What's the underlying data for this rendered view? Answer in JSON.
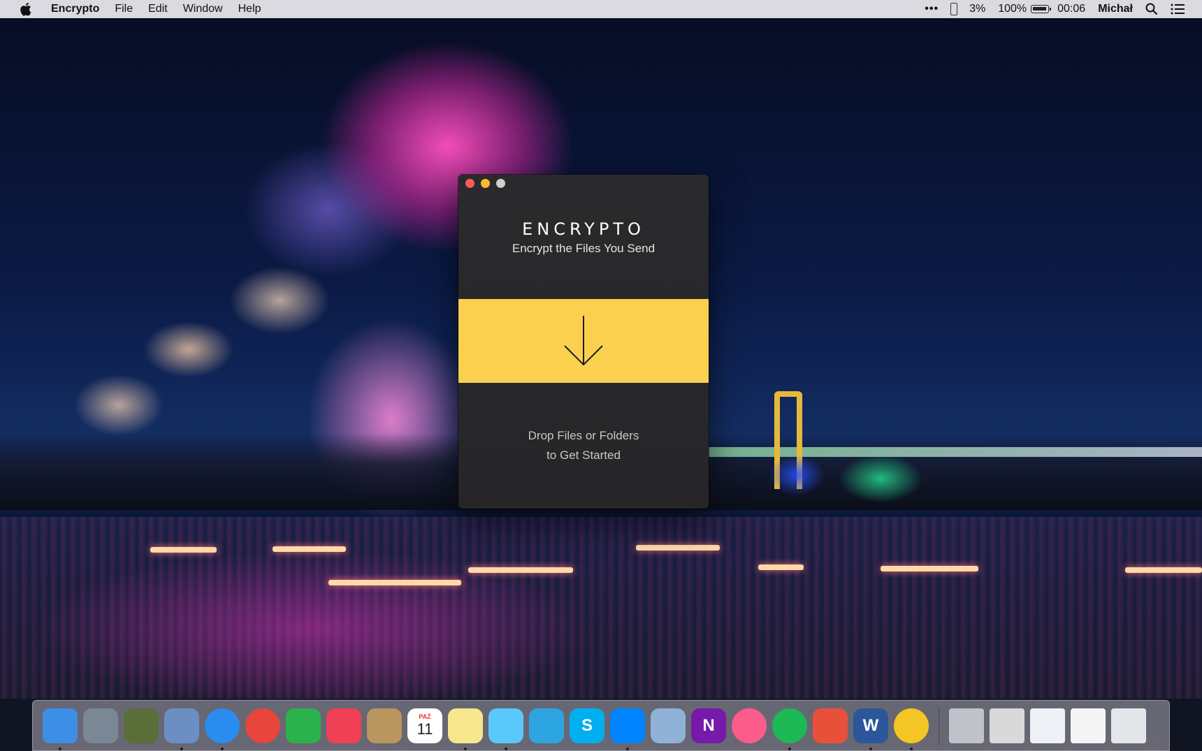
{
  "menubar": {
    "app_name": "Encrypto",
    "menus": [
      "File",
      "Edit",
      "Window",
      "Help"
    ],
    "status": {
      "overflow": "•••",
      "phone_battery": "3%",
      "battery": "100%",
      "time": "00:06",
      "user": "Michał"
    },
    "icons": [
      "apple-icon",
      "phone-icon",
      "battery-icon",
      "spotlight-search-icon",
      "notification-center-icon"
    ]
  },
  "window": {
    "brand": "ENCRYPTO",
    "tagline": "Encrypt the Files You Send",
    "drop_hint_line1": "Drop Files or Folders",
    "drop_hint_line2": "to Get Started",
    "accent_color": "#fcd04f",
    "drop_icon": "down-arrow-icon"
  },
  "dock": {
    "apps": [
      {
        "name": "finder",
        "color": "#3d8fe6",
        "running": true
      },
      {
        "name": "launchpad",
        "color": "#7a8896",
        "running": false
      },
      {
        "name": "mission-control",
        "color": "#5a6e3a",
        "running": false
      },
      {
        "name": "mail-stamp",
        "color": "#6b8fc2",
        "running": true
      },
      {
        "name": "safari",
        "color": "#2b8cf0",
        "running": true
      },
      {
        "name": "chrome",
        "color": "#e8453c",
        "running": false
      },
      {
        "name": "feedly",
        "color": "#2bb24c",
        "running": false
      },
      {
        "name": "pocket",
        "color": "#ef4056",
        "running": false
      },
      {
        "name": "contacts",
        "color": "#b9955f",
        "running": false
      },
      {
        "name": "calendar",
        "color": "#ffffff",
        "running": false
      },
      {
        "name": "notes",
        "color": "#f7e78c",
        "running": true
      },
      {
        "name": "messages",
        "color": "#5ac8fa",
        "running": true
      },
      {
        "name": "telegram",
        "color": "#2ca5e0",
        "running": false
      },
      {
        "name": "skype",
        "color": "#00aff0",
        "running": false
      },
      {
        "name": "messenger",
        "color": "#0084ff",
        "running": true
      },
      {
        "name": "preview",
        "color": "#8fb2d6",
        "running": false
      },
      {
        "name": "onenote",
        "color": "#7719aa",
        "running": false
      },
      {
        "name": "itunes",
        "color": "#fc5c8c",
        "running": false
      },
      {
        "name": "spotify",
        "color": "#1db954",
        "running": true
      },
      {
        "name": "transmit",
        "color": "#e8503a",
        "running": false
      },
      {
        "name": "word",
        "color": "#2b579a",
        "running": true
      },
      {
        "name": "encrypto",
        "color": "#f3c623",
        "running": true
      }
    ],
    "calendar_day": "11",
    "calendar_month": "PAŹ",
    "onenote_letter": "N",
    "word_letter": "W",
    "skype_letter": "S"
  }
}
